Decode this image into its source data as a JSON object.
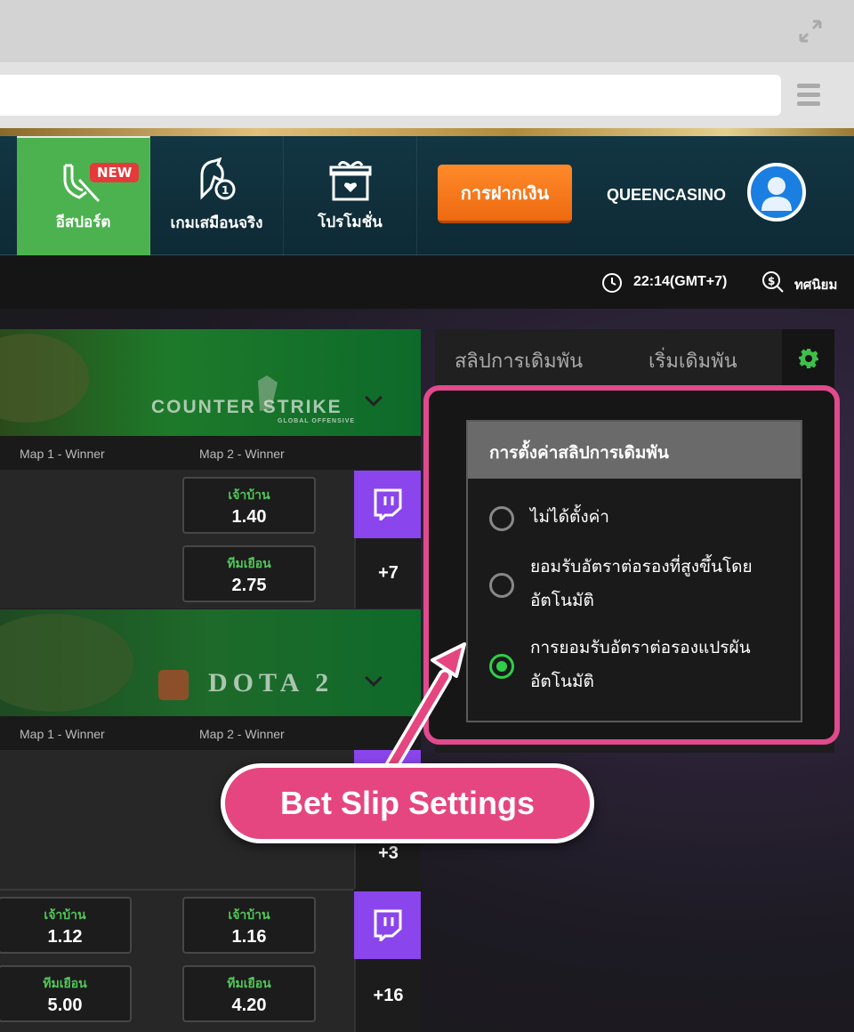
{
  "header": {
    "nav": [
      {
        "label": "อีสปอร์ต",
        "badge": "NEW",
        "icon": "esports-icon",
        "active": true
      },
      {
        "label": "เกมเสมือนจริง",
        "icon": "virtual-horse-icon"
      },
      {
        "label": "โปรโมชั่น",
        "icon": "gift-icon"
      }
    ],
    "deposit_label": "การฝากเงิน",
    "username": "QUEENCASINO"
  },
  "info_bar": {
    "time": "22:14(GMT+7)",
    "odds_format": "ทศนิยม"
  },
  "games": [
    {
      "banner": "COUNTER STRIKE",
      "banner_sub": "GLOBAL OFFENSIVE",
      "markets": [
        "Map 1 - Winner",
        "Map 2 - Winner"
      ],
      "rows": [
        {
          "odds": [
            {
              "label": "เจ้าบ้าน",
              "value": "1.40"
            },
            {
              "label": "ทีมเยือน",
              "value": "2.75"
            }
          ],
          "more": "+7"
        }
      ]
    },
    {
      "banner": "DOTA 2",
      "markets": [
        "Map 1 - Winner",
        "Map 2 - Winner"
      ],
      "rows": [
        {
          "more": "+3"
        },
        {
          "odds": [
            {
              "label": "เจ้าบ้าน",
              "value": "1.12"
            },
            {
              "label": "ทีมเยือน",
              "value": "5.00"
            },
            {
              "label": "เจ้าบ้าน",
              "value": "1.16"
            },
            {
              "label": "ทีมเยือน",
              "value": "4.20"
            }
          ],
          "more": "+16"
        }
      ]
    }
  ],
  "bet_slip": {
    "tabs": [
      "สลิปการเดิมพัน",
      "เริ่มเดิมพัน"
    ],
    "settings_title": "การตั้งค่าสลิปการเดิมพัน",
    "options": [
      {
        "label": "ไม่ได้ตั้งค่า",
        "selected": false
      },
      {
        "label": "ยอมรับอัตราต่อรองที่สูงขึ้นโดยอัตโนมัติ",
        "selected": false
      },
      {
        "label": "การยอมรับอัตราต่อรองแปรผันอัตโนมัติ",
        "selected": true
      }
    ]
  },
  "callout": "Bet Slip Settings",
  "colors": {
    "accent_green": "#4cb24f",
    "deposit_orange": "#f07a1a",
    "highlight_pink": "#e14a8c",
    "twitch_purple": "#8a46ec"
  }
}
